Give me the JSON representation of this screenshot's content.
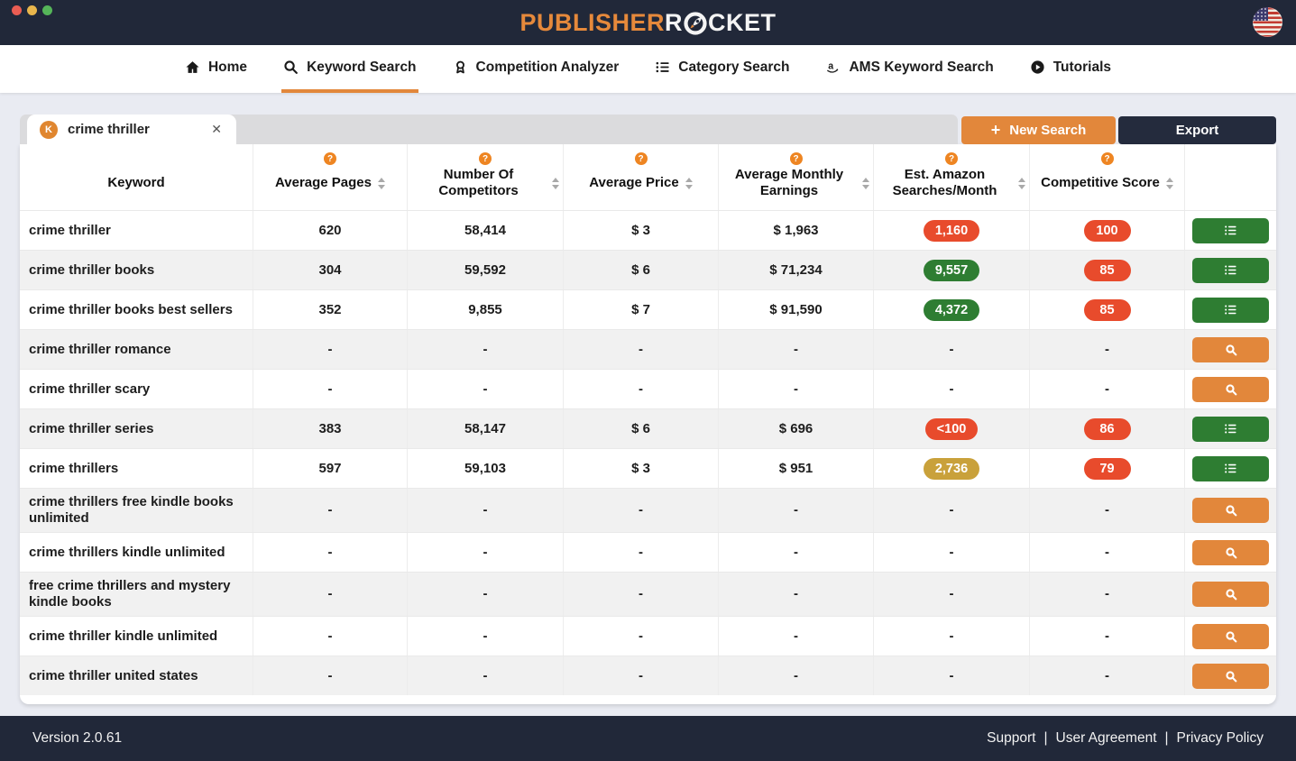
{
  "topbar": {
    "logo": {
      "orange": "PUBLISHER",
      "white_prefix": "R",
      "white_suffix": "CKET"
    },
    "flag_country": "united-states"
  },
  "nav": {
    "items": [
      {
        "id": "home",
        "label": "Home",
        "icon": "home-icon",
        "active": false
      },
      {
        "id": "keyword-search",
        "label": "Keyword Search",
        "icon": "search-icon",
        "active": true
      },
      {
        "id": "competition-analyzer",
        "label": "Competition Analyzer",
        "icon": "medal-icon",
        "active": false
      },
      {
        "id": "category-search",
        "label": "Category Search",
        "icon": "list-icon",
        "active": false
      },
      {
        "id": "ams-keyword-search",
        "label": "AMS Keyword Search",
        "icon": "amazon-icon",
        "active": false
      },
      {
        "id": "tutorials",
        "label": "Tutorials",
        "icon": "play-icon",
        "active": false
      }
    ]
  },
  "toolbar": {
    "tab": {
      "badge": "K",
      "label": "crime thriller",
      "close_glyph": "✕"
    },
    "new_search_icon": "+",
    "new_search_label": "New Search",
    "export_label": "Export"
  },
  "table": {
    "columns": [
      {
        "label": "Keyword",
        "help": false,
        "sort": false
      },
      {
        "label": "Average Pages",
        "help": true,
        "sort": true
      },
      {
        "label": "Number Of Competitors",
        "help": true,
        "sort": true
      },
      {
        "label": "Average Price",
        "help": true,
        "sort": true
      },
      {
        "label": "Average Monthly Earnings",
        "help": true,
        "sort": true
      },
      {
        "label": "Est. Amazon Searches/Month",
        "help": true,
        "sort": true
      },
      {
        "label": "Competitive Score",
        "help": true,
        "sort": true
      }
    ],
    "rows": [
      {
        "keyword": "crime thriller",
        "avg_pages": "620",
        "competitors": "58,414",
        "price": "$ 3",
        "earnings": "$ 1,963",
        "searches": {
          "value": "1,160",
          "status": "red"
        },
        "score": {
          "value": "100",
          "status": "red"
        },
        "action": "list"
      },
      {
        "keyword": "crime thriller books",
        "avg_pages": "304",
        "competitors": "59,592",
        "price": "$ 6",
        "earnings": "$ 71,234",
        "searches": {
          "value": "9,557",
          "status": "green"
        },
        "score": {
          "value": "85",
          "status": "red"
        },
        "action": "list"
      },
      {
        "keyword": "crime thriller books best sellers",
        "avg_pages": "352",
        "competitors": "9,855",
        "price": "$ 7",
        "earnings": "$ 91,590",
        "searches": {
          "value": "4,372",
          "status": "green"
        },
        "score": {
          "value": "85",
          "status": "red"
        },
        "action": "list"
      },
      {
        "keyword": "crime thriller romance",
        "avg_pages": "-",
        "competitors": "-",
        "price": "-",
        "earnings": "-",
        "searches": {
          "value": "-",
          "status": "none"
        },
        "score": {
          "value": "-",
          "status": "none"
        },
        "action": "search"
      },
      {
        "keyword": "crime thriller scary",
        "avg_pages": "-",
        "competitors": "-",
        "price": "-",
        "earnings": "-",
        "searches": {
          "value": "-",
          "status": "none"
        },
        "score": {
          "value": "-",
          "status": "none"
        },
        "action": "search"
      },
      {
        "keyword": "crime thriller series",
        "avg_pages": "383",
        "competitors": "58,147",
        "price": "$ 6",
        "earnings": "$ 696",
        "searches": {
          "value": "<100",
          "status": "red"
        },
        "score": {
          "value": "86",
          "status": "red"
        },
        "action": "list"
      },
      {
        "keyword": "crime thrillers",
        "avg_pages": "597",
        "competitors": "59,103",
        "price": "$ 3",
        "earnings": "$ 951",
        "searches": {
          "value": "2,736",
          "status": "yellow"
        },
        "score": {
          "value": "79",
          "status": "red"
        },
        "action": "list"
      },
      {
        "keyword": "crime thrillers free kindle books unlimited",
        "avg_pages": "-",
        "competitors": "-",
        "price": "-",
        "earnings": "-",
        "searches": {
          "value": "-",
          "status": "none"
        },
        "score": {
          "value": "-",
          "status": "none"
        },
        "action": "search"
      },
      {
        "keyword": "crime thrillers kindle unlimited",
        "avg_pages": "-",
        "competitors": "-",
        "price": "-",
        "earnings": "-",
        "searches": {
          "value": "-",
          "status": "none"
        },
        "score": {
          "value": "-",
          "status": "none"
        },
        "action": "search"
      },
      {
        "keyword": "free crime thrillers and mystery kindle books",
        "avg_pages": "-",
        "competitors": "-",
        "price": "-",
        "earnings": "-",
        "searches": {
          "value": "-",
          "status": "none"
        },
        "score": {
          "value": "-",
          "status": "none"
        },
        "action": "search"
      },
      {
        "keyword": "crime thriller kindle unlimited",
        "avg_pages": "-",
        "competitors": "-",
        "price": "-",
        "earnings": "-",
        "searches": {
          "value": "-",
          "status": "none"
        },
        "score": {
          "value": "-",
          "status": "none"
        },
        "action": "search"
      },
      {
        "keyword": "crime thriller united states",
        "avg_pages": "-",
        "competitors": "-",
        "price": "-",
        "earnings": "-",
        "searches": {
          "value": "-",
          "status": "none"
        },
        "score": {
          "value": "-",
          "status": "none"
        },
        "action": "search"
      }
    ]
  },
  "footer": {
    "version": "Version 2.0.61",
    "links": [
      "Support",
      "User Agreement",
      "Privacy Policy"
    ]
  },
  "colors": {
    "navy": "#212839",
    "accent_orange": "#e2873b",
    "badge_red": "#e84b2c",
    "badge_green": "#2e7d32",
    "badge_yellow": "#c9a13b"
  }
}
